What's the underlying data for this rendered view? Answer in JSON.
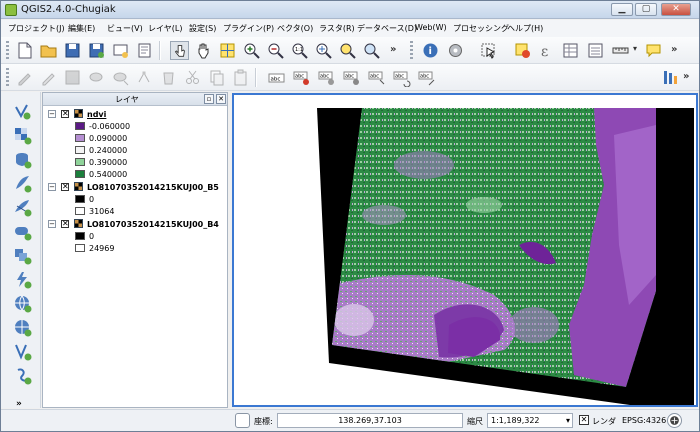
{
  "window": {
    "title": "QGIS2.4.0-Chugiak"
  },
  "menu": [
    "プロジェクト(J)",
    "編集(E)",
    "ビュー(V)",
    "レイヤ(L)",
    "設定(S)",
    "プラグイン(P)",
    "ベクタ(O)",
    "ラスタ(R)",
    "データベース(D)",
    "Web(W)",
    "プロセッシング",
    "ヘルプ(H)"
  ],
  "layers_panel": {
    "title": "レイヤ",
    "layers": [
      {
        "name": "ndvi",
        "legend": [
          {
            "value": "-0.060000",
            "color": "#5b1a85"
          },
          {
            "value": "0.090000",
            "color": "#b58fd2"
          },
          {
            "value": "0.240000",
            "color": "#f4f4f4"
          },
          {
            "value": "0.390000",
            "color": "#8fd39a"
          },
          {
            "value": "0.540000",
            "color": "#1b7f3c"
          }
        ]
      },
      {
        "name": "LO81070352014215KUJ00_B5",
        "legend": [
          {
            "value": "0",
            "color": "#000000"
          },
          {
            "value": "31064",
            "color": "#ffffff"
          }
        ]
      },
      {
        "name": "LO81070352014215KUJ00_B4",
        "legend": [
          {
            "value": "0",
            "color": "#000000"
          },
          {
            "value": "24969",
            "color": "#ffffff"
          }
        ]
      }
    ]
  },
  "statusbar": {
    "coord_label": "座標:",
    "coord_value": "138.269,37.103",
    "scale_label": "縮尺",
    "scale_value": "1:1,189,322",
    "render_label": "レンダ",
    "crs": "EPSG:4326"
  },
  "colors": {
    "ndvi_low": "#7d3aa8",
    "ndvi_high": "#2c8a45",
    "map_border": "#3b78d2"
  }
}
